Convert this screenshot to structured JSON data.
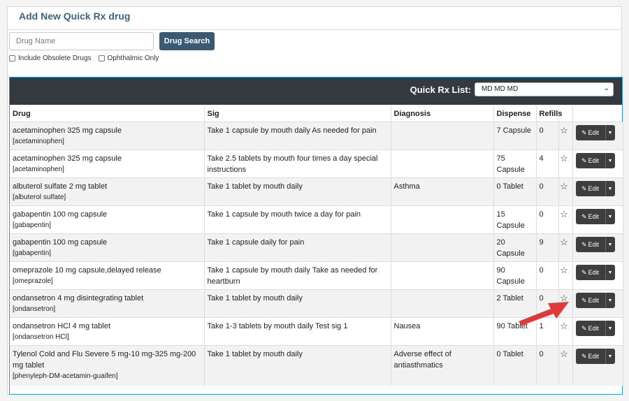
{
  "header": {
    "title": "Add New Quick Rx drug"
  },
  "search": {
    "placeholder": "Drug Name",
    "value": "",
    "button_label": "Drug Search"
  },
  "filters": [
    {
      "label": "Include Obsolete Drugs",
      "checked": false
    },
    {
      "label": "Ophthalmic Only",
      "checked": false
    }
  ],
  "quick_rx": {
    "label": "Quick Rx List:",
    "selected": "MD MD MD"
  },
  "table": {
    "columns": [
      "Drug",
      "Sig",
      "Diagnosis",
      "Dispense",
      "Refills",
      "",
      ""
    ],
    "edit_label": "Edit",
    "rows": [
      {
        "drug": "acetaminophen 325 mg capsule",
        "generic": "[acetaminophen]",
        "sig": "Take 1 capsule by mouth daily As needed for pain",
        "diagnosis": "",
        "dispense": "7 Capsule",
        "refills": "0"
      },
      {
        "drug": "acetaminophen 325 mg capsule",
        "generic": "[acetaminophen]",
        "sig": "Take 2.5 tablets by mouth four times a day special instructions",
        "diagnosis": "",
        "dispense": "75 Capsule",
        "refills": "4"
      },
      {
        "drug": "albuterol sulfate 2 mg tablet",
        "generic": "[albuterol sulfate]",
        "sig": "Take 1 tablet by mouth daily",
        "diagnosis": "Asthma",
        "dispense": "0 Tablet",
        "refills": "0"
      },
      {
        "drug": "gabapentin 100 mg capsule",
        "generic": "[gabapentin]",
        "sig": "Take 1 capsule by mouth twice a day for pain",
        "diagnosis": "",
        "dispense": "15 Capsule",
        "refills": "0"
      },
      {
        "drug": "gabapentin 100 mg capsule",
        "generic": "[gabapentin]",
        "sig": "Take 1 capsule daily for pain",
        "diagnosis": "",
        "dispense": "20 Capsule",
        "refills": "9"
      },
      {
        "drug": "omeprazole 10 mg capsule,delayed release",
        "generic": "[omeprazole]",
        "sig": "Take 1 capsule by mouth daily Take as needed for heartburn",
        "diagnosis": "",
        "dispense": "90 Capsule",
        "refills": "0"
      },
      {
        "drug": "ondansetron 4 mg disintegrating tablet",
        "generic": "[ondansetron]",
        "sig": "Take 1 tablet by mouth daily",
        "diagnosis": "",
        "dispense": "2 Tablet",
        "refills": "0"
      },
      {
        "drug": "ondansetron HCl 4 mg tablet",
        "generic": "[ondansetron HCl]",
        "sig": "Take 1-3 tablets by mouth daily Test sig 1",
        "diagnosis": "Nausea",
        "dispense": "90 Tablet",
        "refills": "1"
      },
      {
        "drug": "Tylenol Cold and Flu Severe 5 mg-10 mg-325 mg-200 mg tablet",
        "generic": "[phenyleph-DM-acetamin-guaifen]",
        "sig": "Take 1 tablet by mouth daily",
        "diagnosis": "Adverse effect of antiasthmatics",
        "dispense": "0 Tablet",
        "refills": "0"
      }
    ]
  },
  "colors": {
    "title": "#3c6483",
    "search_button": "#3a5a74",
    "dark_bar": "#343a40",
    "edit_button": "#3e3e3e",
    "arrow": "#e0393a",
    "section_border": "#2f97d4"
  }
}
